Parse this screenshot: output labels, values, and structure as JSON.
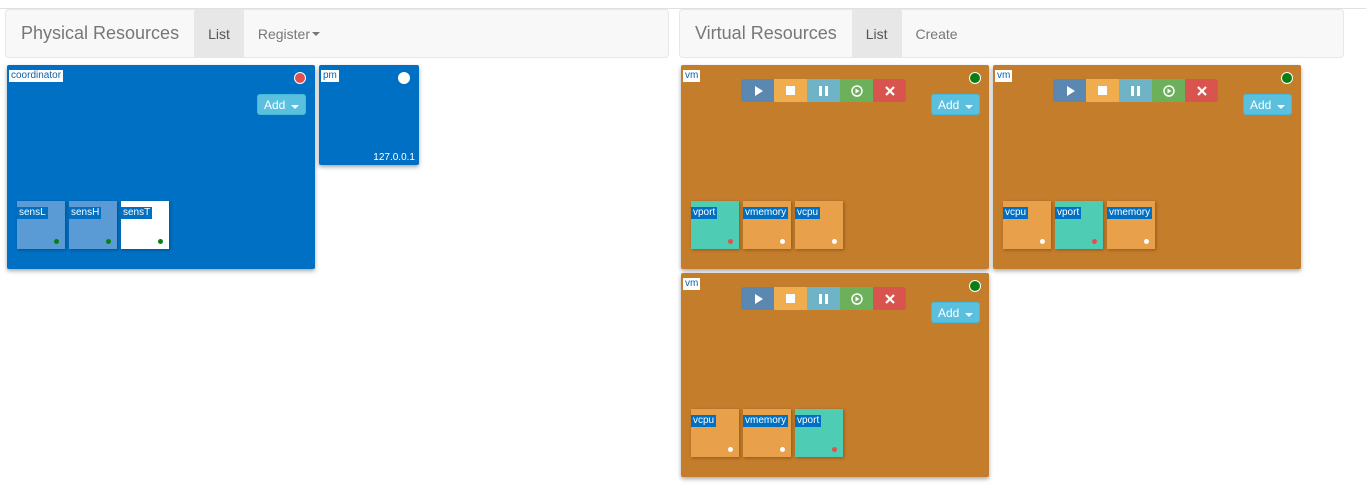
{
  "physical": {
    "title": "Physical Resources",
    "tabs": [
      {
        "label": "List",
        "active": true
      },
      {
        "label": "Register",
        "dropdown": true
      }
    ],
    "nodes": [
      {
        "label": "coordinator",
        "status": "red",
        "add_label": "Add",
        "children": [
          {
            "label": "sensL",
            "bg": "#5b9bd5",
            "dot": "#0a7e14"
          },
          {
            "label": "sensH",
            "bg": "#5b9bd5",
            "dot": "#0a7e14"
          },
          {
            "label": "sensT",
            "bg": "#ffffff",
            "dot": "#0a7e14"
          }
        ]
      },
      {
        "label": "pm",
        "status": "white",
        "ip": "127.0.0.1"
      }
    ]
  },
  "virtual": {
    "title": "Virtual Resources",
    "tabs": [
      {
        "label": "List",
        "active": true
      },
      {
        "label": "Create"
      }
    ],
    "controls": [
      "play-icon",
      "stop-icon",
      "pause-icon",
      "reboot-icon",
      "delete-icon"
    ],
    "nodes": [
      {
        "label": "vm",
        "status": "green",
        "add_label": "Add",
        "children": [
          {
            "label": "vport",
            "bg": "#4ecdb4",
            "dot": "#e05050"
          },
          {
            "label": "vmemory",
            "bg": "#e8a04b",
            "dot": "#ffffff"
          },
          {
            "label": "vcpu",
            "bg": "#e8a04b",
            "dot": "#ffffff"
          }
        ]
      },
      {
        "label": "vm",
        "status": "green",
        "add_label": "Add",
        "children": [
          {
            "label": "vcpu",
            "bg": "#e8a04b",
            "dot": "#ffffff"
          },
          {
            "label": "vport",
            "bg": "#4ecdb4",
            "dot": "#e05050"
          },
          {
            "label": "vmemory",
            "bg": "#e8a04b",
            "dot": "#ffffff"
          }
        ]
      },
      {
        "label": "vm",
        "status": "green",
        "add_label": "Add",
        "children": [
          {
            "label": "vcpu",
            "bg": "#e8a04b",
            "dot": "#ffffff"
          },
          {
            "label": "vmemory",
            "bg": "#e8a04b",
            "dot": "#ffffff"
          },
          {
            "label": "vport",
            "bg": "#4ecdb4",
            "dot": "#e05050"
          }
        ]
      }
    ]
  },
  "colors": {
    "physical_node": "#0070c4",
    "virtual_node": "#c47d2a",
    "add_button": "#5bc0de",
    "play": "#5b88b0",
    "stop": "#f0ad4e",
    "pause": "#6fb4c6",
    "reboot": "#6cb05c",
    "delete": "#d9534f"
  }
}
